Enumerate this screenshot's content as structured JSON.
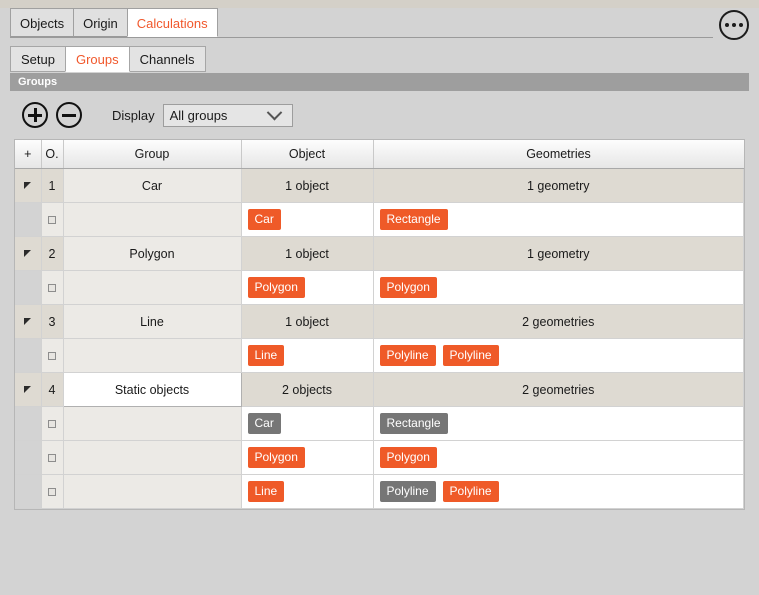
{
  "window": {
    "more_options_icon": "ellipsis-circle-icon"
  },
  "main_tabs": [
    {
      "label": "Objects",
      "active": false
    },
    {
      "label": "Origin",
      "active": false
    },
    {
      "label": "Calculations",
      "active": true
    }
  ],
  "sub_tabs": [
    {
      "label": "Setup",
      "active": false
    },
    {
      "label": "Groups",
      "active": true
    },
    {
      "label": "Channels",
      "active": false
    }
  ],
  "section": {
    "title": "Groups"
  },
  "toolbar": {
    "add_icon": "plus-circle-icon",
    "remove_icon": "minus-circle-icon",
    "display_label": "Display",
    "display_value": "All groups",
    "display_options": [
      "All groups"
    ],
    "chevron_icon": "chevron-down-icon"
  },
  "table": {
    "columns": [
      "+",
      "O.",
      "Group",
      "Object",
      "Geometries"
    ],
    "rows": [
      {
        "order": "1",
        "group": "Car",
        "group_editing": false,
        "object_summary": "1 object",
        "geometry_summary": "1 geometry",
        "children": [
          {
            "objects": [
              {
                "label": "Car",
                "color": "orange"
              }
            ],
            "geometries": [
              {
                "label": "Rectangle",
                "color": "orange"
              }
            ]
          }
        ]
      },
      {
        "order": "2",
        "group": "Polygon",
        "group_editing": false,
        "object_summary": "1 object",
        "geometry_summary": "1 geometry",
        "children": [
          {
            "objects": [
              {
                "label": "Polygon",
                "color": "orange"
              }
            ],
            "geometries": [
              {
                "label": "Polygon",
                "color": "orange"
              }
            ]
          }
        ]
      },
      {
        "order": "3",
        "group": "Line",
        "group_editing": false,
        "object_summary": "1 object",
        "geometry_summary": "2 geometries",
        "children": [
          {
            "objects": [
              {
                "label": "Line",
                "color": "orange"
              }
            ],
            "geometries": [
              {
                "label": "Polyline",
                "color": "orange"
              },
              {
                "label": "Polyline",
                "color": "orange"
              }
            ]
          }
        ]
      },
      {
        "order": "4",
        "group": "Static objects",
        "group_editing": true,
        "object_summary": "2 objects",
        "geometry_summary": "2 geometries",
        "children": [
          {
            "objects": [
              {
                "label": "Car",
                "color": "gray"
              }
            ],
            "geometries": [
              {
                "label": "Rectangle",
                "color": "gray"
              }
            ]
          },
          {
            "objects": [
              {
                "label": "Polygon",
                "color": "orange"
              }
            ],
            "geometries": [
              {
                "label": "Polygon",
                "color": "orange"
              }
            ]
          },
          {
            "objects": [
              {
                "label": "Line",
                "color": "orange"
              }
            ],
            "geometries": [
              {
                "label": "Polyline",
                "color": "gray"
              },
              {
                "label": "Polyline",
                "color": "orange"
              }
            ]
          }
        ]
      }
    ]
  },
  "colors": {
    "accent": "#ef5a28",
    "chip_orange": "#ef5a28",
    "chip_gray": "#767676",
    "band_gray": "#9e9e9e",
    "window_bg": "#d3d3d3"
  }
}
